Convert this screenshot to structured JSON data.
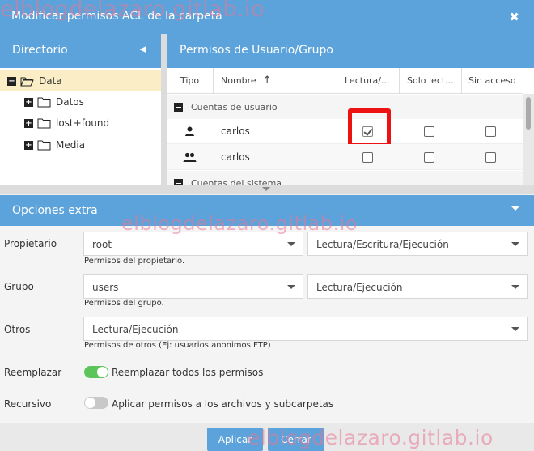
{
  "dialog": {
    "title": "Modificar permisos ACL de la carpeta",
    "close_symbol": "✖"
  },
  "directory": {
    "header": "Directorio",
    "collapse_symbol": "◀",
    "items": [
      {
        "label": "Data",
        "expander": "minus",
        "selected": true
      },
      {
        "label": "Datos",
        "expander": "plus"
      },
      {
        "label": "lost+found",
        "expander": "plus"
      },
      {
        "label": "Media",
        "expander": "plus"
      }
    ]
  },
  "permissions": {
    "header": "Permisos de Usuario/Grupo",
    "columns": [
      "Tipo",
      "Nombre",
      "Lectura/...",
      "Solo lect...",
      "Sin acceso"
    ],
    "sort_indicator": "↑",
    "groups": [
      {
        "label": "Cuentas de usuario",
        "rows": [
          {
            "type_icon": "user-icon",
            "name": "carlos",
            "read": true,
            "readonly": false,
            "noaccess": false,
            "highlighted": true
          },
          {
            "type_icon": "group-icon",
            "name": "carlos",
            "read": false,
            "readonly": false,
            "noaccess": false,
            "highlighted": false
          }
        ]
      },
      {
        "label": "Cuentas del sistema",
        "rows": []
      }
    ]
  },
  "options": {
    "header": "Opciones extra",
    "owner": {
      "label": "Propietario",
      "user": "root",
      "perm": "Lectura/Escritura/Ejecución",
      "hint": "Permisos del propietario."
    },
    "group": {
      "label": "Grupo",
      "user": "users",
      "perm": "Lectura/Ejecución",
      "hint": "Permisos del grupo."
    },
    "others": {
      "label": "Otros",
      "perm": "Lectura/Ejecución",
      "hint": "Permisos de otros (Ej: usuarios anonimos FTP)"
    },
    "replace": {
      "label": "Reemplazar",
      "text": "Reemplazar todos los permisos",
      "on": true
    },
    "recursive": {
      "label": "Recursivo",
      "text": "Aplicar permisos a los archivos y subcarpetas",
      "on": false
    }
  },
  "footer": {
    "apply": "Aplicar",
    "cancel": "Cerrar"
  },
  "watermark": "elblogdelazaro.gitlab.io",
  "colors": {
    "header": "#5ba3da",
    "selected_row": "#fbeec6",
    "highlight": "#ee1111",
    "switch_on": "#5cc55a"
  }
}
